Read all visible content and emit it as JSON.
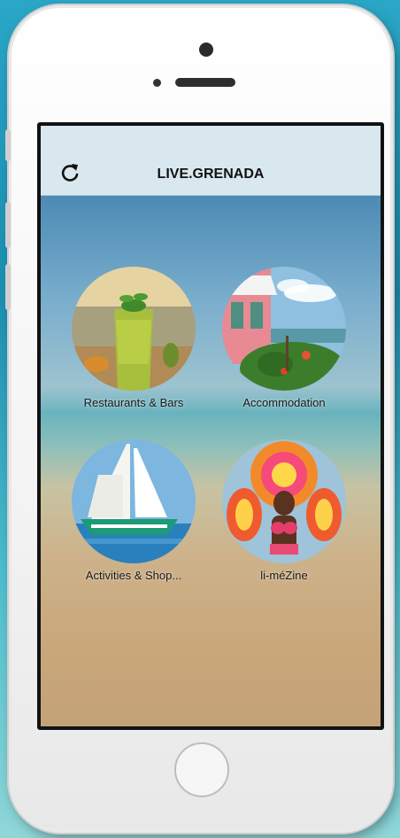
{
  "app": {
    "title": "LIVE.GRENADA",
    "refresh_icon": "refresh-icon"
  },
  "tiles": [
    {
      "label": "Restaurants & Bars"
    },
    {
      "label": "Accommodation"
    },
    {
      "label": "Activities & Shop..."
    },
    {
      "label": "li-méZine"
    }
  ]
}
